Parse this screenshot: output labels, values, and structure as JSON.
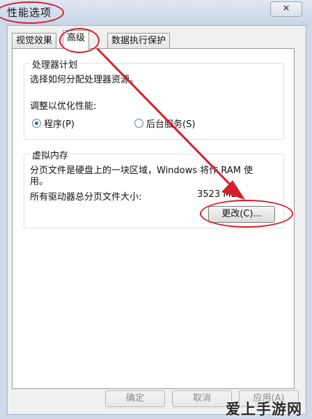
{
  "window": {
    "title": "性能选项",
    "close_glyph": "✕"
  },
  "tabs": [
    {
      "label": "视觉效果",
      "active": false
    },
    {
      "label": "高级",
      "active": true
    },
    {
      "label": "数据执行保护",
      "active": false
    }
  ],
  "processor_scheduling": {
    "title": "处理器计划",
    "description": "选择如何分配处理器资源。",
    "adjust_label": "调整以优化性能:",
    "options": [
      {
        "label": "程序(P)",
        "selected": true
      },
      {
        "label": "后台服务(S)",
        "selected": false
      }
    ]
  },
  "virtual_memory": {
    "title": "虚拟内存",
    "description_line1": "分页文件是硬盘上的一块区域，Windows 将作 RAM 使",
    "description_line2": "用。",
    "total_label": "所有驱动器总分页文件大小:",
    "total_value": "3523 MB",
    "change_button": "更改(C)..."
  },
  "footer": {
    "ok_button": "确定",
    "cancel_button": "取消",
    "apply_button": "应用(A)"
  },
  "annotation_color": "#d61f2a",
  "watermark": "爱上手游网"
}
